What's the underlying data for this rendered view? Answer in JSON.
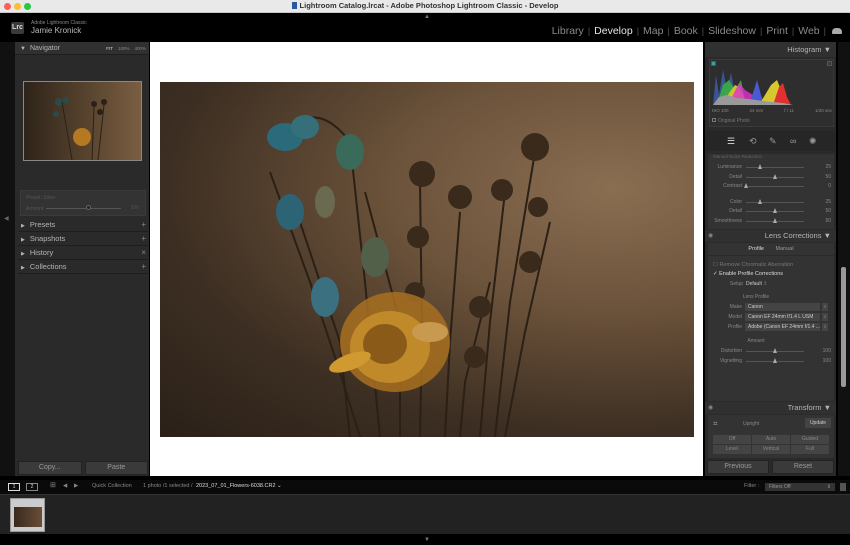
{
  "window": {
    "title": "Lightroom Catalog.lrcat - Adobe Photoshop Lightroom Classic - Develop"
  },
  "identity": {
    "logo": "Lrc",
    "app_name": "Adobe Lightroom Classic",
    "user": "Jamie Kronick"
  },
  "modules": [
    {
      "label": "Library",
      "active": false
    },
    {
      "label": "Develop",
      "active": true
    },
    {
      "label": "Map",
      "active": false
    },
    {
      "label": "Book",
      "active": false
    },
    {
      "label": "Slideshow",
      "active": false
    },
    {
      "label": "Print",
      "active": false
    },
    {
      "label": "Web",
      "active": false
    }
  ],
  "left_panel": {
    "navigator": {
      "title": "Navigator",
      "zoom_options": [
        "FIT",
        "100%",
        "400%"
      ]
    },
    "preset": {
      "label": "Preset: Silver",
      "amount_label": "Amount",
      "amount_value": "100"
    },
    "sections": [
      {
        "label": "Presets",
        "action": "+"
      },
      {
        "label": "Snapshots",
        "action": "+"
      },
      {
        "label": "History",
        "action": "×"
      },
      {
        "label": "Collections",
        "action": "+"
      }
    ],
    "buttons": {
      "copy": "Copy...",
      "paste": "Paste"
    }
  },
  "right_panel": {
    "histogram": {
      "title": "Histogram",
      "iso": "ISO 100",
      "focal": "24 mm",
      "aperture": "f / 11",
      "shutter": "1/40 sec",
      "original_photo": "Original Photo"
    },
    "noise_reduction": {
      "title": "Manual Noise Reduction",
      "sliders": [
        {
          "label": "Luminance",
          "value": "25",
          "pct": 0.25
        },
        {
          "label": "Detail",
          "value": "50",
          "pct": 0.5
        },
        {
          "label": "Contrast",
          "value": "0",
          "pct": 0.0
        },
        {
          "label": "Color",
          "value": "25",
          "pct": 0.25
        },
        {
          "label": "Detail",
          "value": "50",
          "pct": 0.5
        },
        {
          "label": "Smoothness",
          "value": "50",
          "pct": 0.5
        }
      ]
    },
    "lens_corrections": {
      "title": "Lens Corrections",
      "tabs": [
        {
          "label": "Profile",
          "active": true
        },
        {
          "label": "Manual",
          "active": false
        }
      ],
      "remove_ca": "Remove Chromatic Aberration",
      "enable_profile": "Enable Profile Corrections",
      "setup_label": "Setup",
      "setup_value": "Default",
      "lens_profile_heading": "Lens Profile",
      "make_label": "Make",
      "make_value": "Canon",
      "model_label": "Model",
      "model_value": "Canon EF 24mm f/1.4 L USM",
      "profile_label": "Profile",
      "profile_value": "Adobe (Canon EF 24mm f/1.4 ...",
      "amount_heading": "Amount",
      "sliders": [
        {
          "label": "Distortion",
          "value": "100",
          "pct": 0.5
        },
        {
          "label": "Vignetting",
          "value": "100",
          "pct": 0.5
        }
      ]
    },
    "transform": {
      "title": "Transform",
      "upright_label": "Upright",
      "update_label": "Update",
      "row1": [
        "Off",
        "Auto",
        "Guided"
      ],
      "row2": [
        "Level",
        "Vertical",
        "Full"
      ]
    },
    "buttons": {
      "previous": "Previous",
      "reset": "Reset"
    }
  },
  "filmstrip": {
    "screen1": "1",
    "screen2": "2",
    "source": "Quick Collection",
    "count": "1 photo /1 selected /",
    "filename": "2023_07_01_Flowers-6038.CR2",
    "filter_label": "Filter :",
    "filter_value": "Filters Off"
  }
}
